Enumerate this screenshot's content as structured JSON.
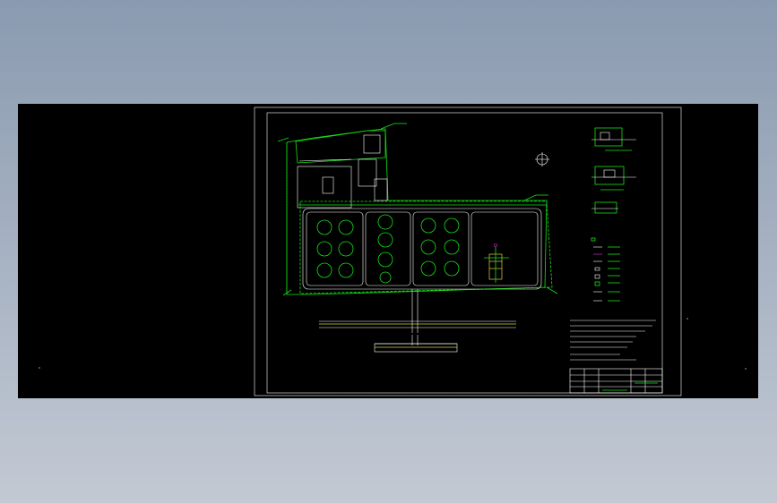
{
  "colors": {
    "background_top": "#8a9ab0",
    "viewport": "#000000",
    "line_green": "#17e317",
    "line_white": "#ffffff",
    "line_yellow": "#d6d639",
    "line_magenta": "#e830e8"
  },
  "icons": {
    "north_arrow": "north-arrow-icon",
    "axis_marker": "crosshair-icon"
  }
}
